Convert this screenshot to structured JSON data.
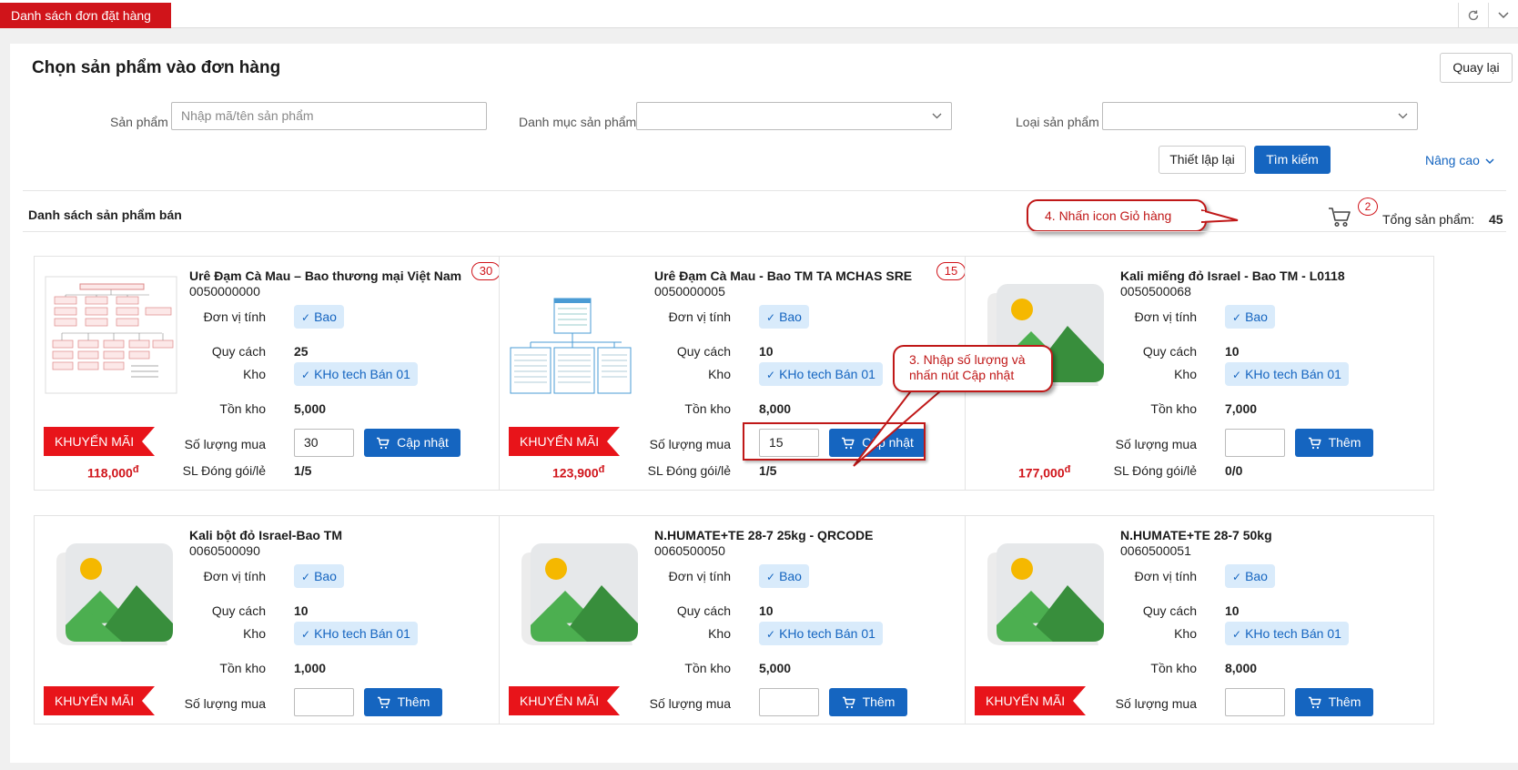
{
  "tab": {
    "label": "Danh sách đơn đặt hàng"
  },
  "page": {
    "title": "Chọn sản phẩm vào đơn hàng",
    "back_label": "Quay lại"
  },
  "filters": {
    "product_label": "Sản phẩm",
    "product_placeholder": "Nhập mã/tên sản phẩm",
    "category_label": "Danh mục sản phẩm",
    "category_value": "",
    "type_label": "Loại sản phẩm",
    "type_value": "",
    "reset_label": "Thiết lập lại",
    "search_label": "Tìm kiếm",
    "advanced_label": "Nâng cao"
  },
  "list": {
    "title": "Danh sách sản phẩm bán",
    "cart_count": "2",
    "total_label": "Tổng sản phẩm:",
    "total_value": "45"
  },
  "callouts": {
    "cart_hint": "4. Nhấn icon Giỏ hàng",
    "qty_hint": "3. Nhập số lượng và nhấn nút Cập nhật"
  },
  "labels": {
    "unit": "Đơn vị tính",
    "spec": "Quy cách",
    "warehouse": "Kho",
    "stock": "Tồn kho",
    "qty": "Số lượng mua",
    "pack": "SL Đóng gói/lẻ",
    "promo": "KHUYẾN MÃI"
  },
  "products": [
    {
      "name": "Urê Đạm Cà Mau – Bao thương mại Việt Nam",
      "code": "0050000000",
      "cart_qty": "30",
      "unit": "Bao",
      "spec": "25",
      "warehouse": "KHo tech Bán 01",
      "stock": "5,000",
      "qty_value": "30",
      "action": "Cập nhật",
      "pack": "1/5",
      "promo": true,
      "price": "118,000",
      "currency": "đ",
      "thumb": "diagram1"
    },
    {
      "name": "Urê Đạm Cà Mau - Bao TM TA MCHAS SRE",
      "code": "0050000005",
      "cart_qty": "15",
      "unit": "Bao",
      "spec": "10",
      "warehouse": "KHo tech Bán 01",
      "stock": "8,000",
      "qty_value": "15",
      "action": "Cập nhật",
      "pack": "1/5",
      "promo": true,
      "price": "123,900",
      "currency": "đ",
      "thumb": "diagram2"
    },
    {
      "name": "Kali miếng đỏ Israel - Bao TM - L0118",
      "code": "0050500068",
      "cart_qty": "",
      "unit": "Bao",
      "spec": "10",
      "warehouse": "KHo tech Bán 01",
      "stock": "7,000",
      "qty_value": "",
      "action": "Thêm",
      "pack": "0/0",
      "promo": false,
      "price": "177,000",
      "currency": "đ",
      "thumb": "placeholder"
    },
    {
      "name": "Kali bột đỏ Israel-Bao TM",
      "code": "0060500090",
      "cart_qty": "",
      "unit": "Bao",
      "spec": "10",
      "warehouse": "KHo tech Bán 01",
      "stock": "1,000",
      "qty_value": "",
      "action": "Thêm",
      "promo": true,
      "thumb": "placeholder"
    },
    {
      "name": "N.HUMATE+TE 28-7 25kg - QRCODE",
      "code": "0060500050",
      "cart_qty": "",
      "unit": "Bao",
      "spec": "10",
      "warehouse": "KHo tech Bán 01",
      "stock": "5,000",
      "qty_value": "",
      "action": "Thêm",
      "promo": true,
      "thumb": "placeholder"
    },
    {
      "name": "N.HUMATE+TE 28-7 50kg",
      "code": "0060500051",
      "cart_qty": "",
      "unit": "Bao",
      "spec": "10",
      "warehouse": "KHo tech Bán 01",
      "stock": "8,000",
      "qty_value": "",
      "action": "Thêm",
      "promo": true,
      "thumb": "placeholder"
    }
  ]
}
